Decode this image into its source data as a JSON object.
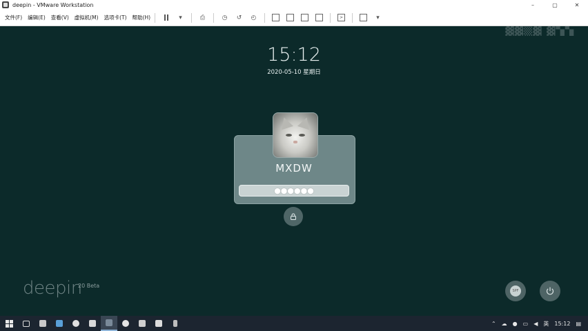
{
  "window": {
    "title": "deepin - VMware Workstation",
    "controls": [
      "–",
      "▢",
      "✕"
    ]
  },
  "menu": [
    {
      "label": "文件(F)"
    },
    {
      "label": "编辑(E)"
    },
    {
      "label": "查看(V)"
    },
    {
      "label": "虚拟机(M)"
    },
    {
      "label": "选项卡(T)"
    },
    {
      "label": "帮助(H)"
    }
  ],
  "lockscreen": {
    "time": "15:12",
    "date": "2020-05-10 星期日",
    "username": "MXDW",
    "password_mask": "●●●●●●",
    "brand": "deepin",
    "version": "20 Beta",
    "keyboard_layout": "SPF"
  },
  "taskbar": {
    "tray_ime": "英",
    "tray_time": "15:12"
  },
  "colors": {
    "background": "#0d2a2b",
    "card": "#6e8788",
    "taskbar": "#1c2530"
  }
}
